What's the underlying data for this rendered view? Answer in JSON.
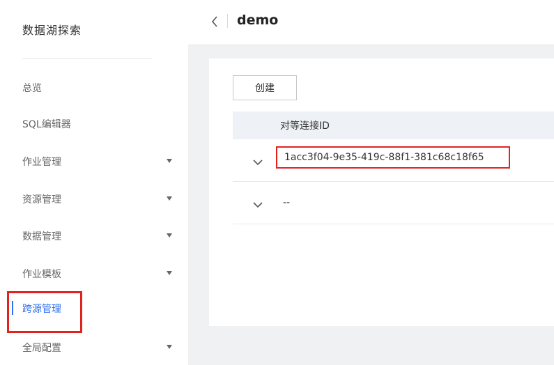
{
  "sidebar": {
    "title": "数据湖探索",
    "items": [
      {
        "label": "总览",
        "has_caret": false
      },
      {
        "label": "SQL编辑器",
        "has_caret": false
      },
      {
        "label": "作业管理",
        "has_caret": true
      },
      {
        "label": "资源管理",
        "has_caret": true
      },
      {
        "label": "数据管理",
        "has_caret": true
      },
      {
        "label": "作业模板",
        "has_caret": true
      },
      {
        "label": "跨源管理",
        "has_caret": false,
        "active": true
      },
      {
        "label": "全局配置",
        "has_caret": true
      }
    ]
  },
  "header": {
    "title": "demo",
    "back_icon": "chevron-left-icon"
  },
  "main": {
    "create_label": "创建",
    "table": {
      "column_header": "对等连接ID",
      "rows": [
        {
          "value": "1acc3f04-9e35-419c-88f1-381c68c18f65"
        },
        {
          "value": "--"
        }
      ]
    }
  },
  "colors": {
    "accent": "#2f6fed",
    "highlight": "#e2221f",
    "page_bg": "#f0f1f3"
  }
}
